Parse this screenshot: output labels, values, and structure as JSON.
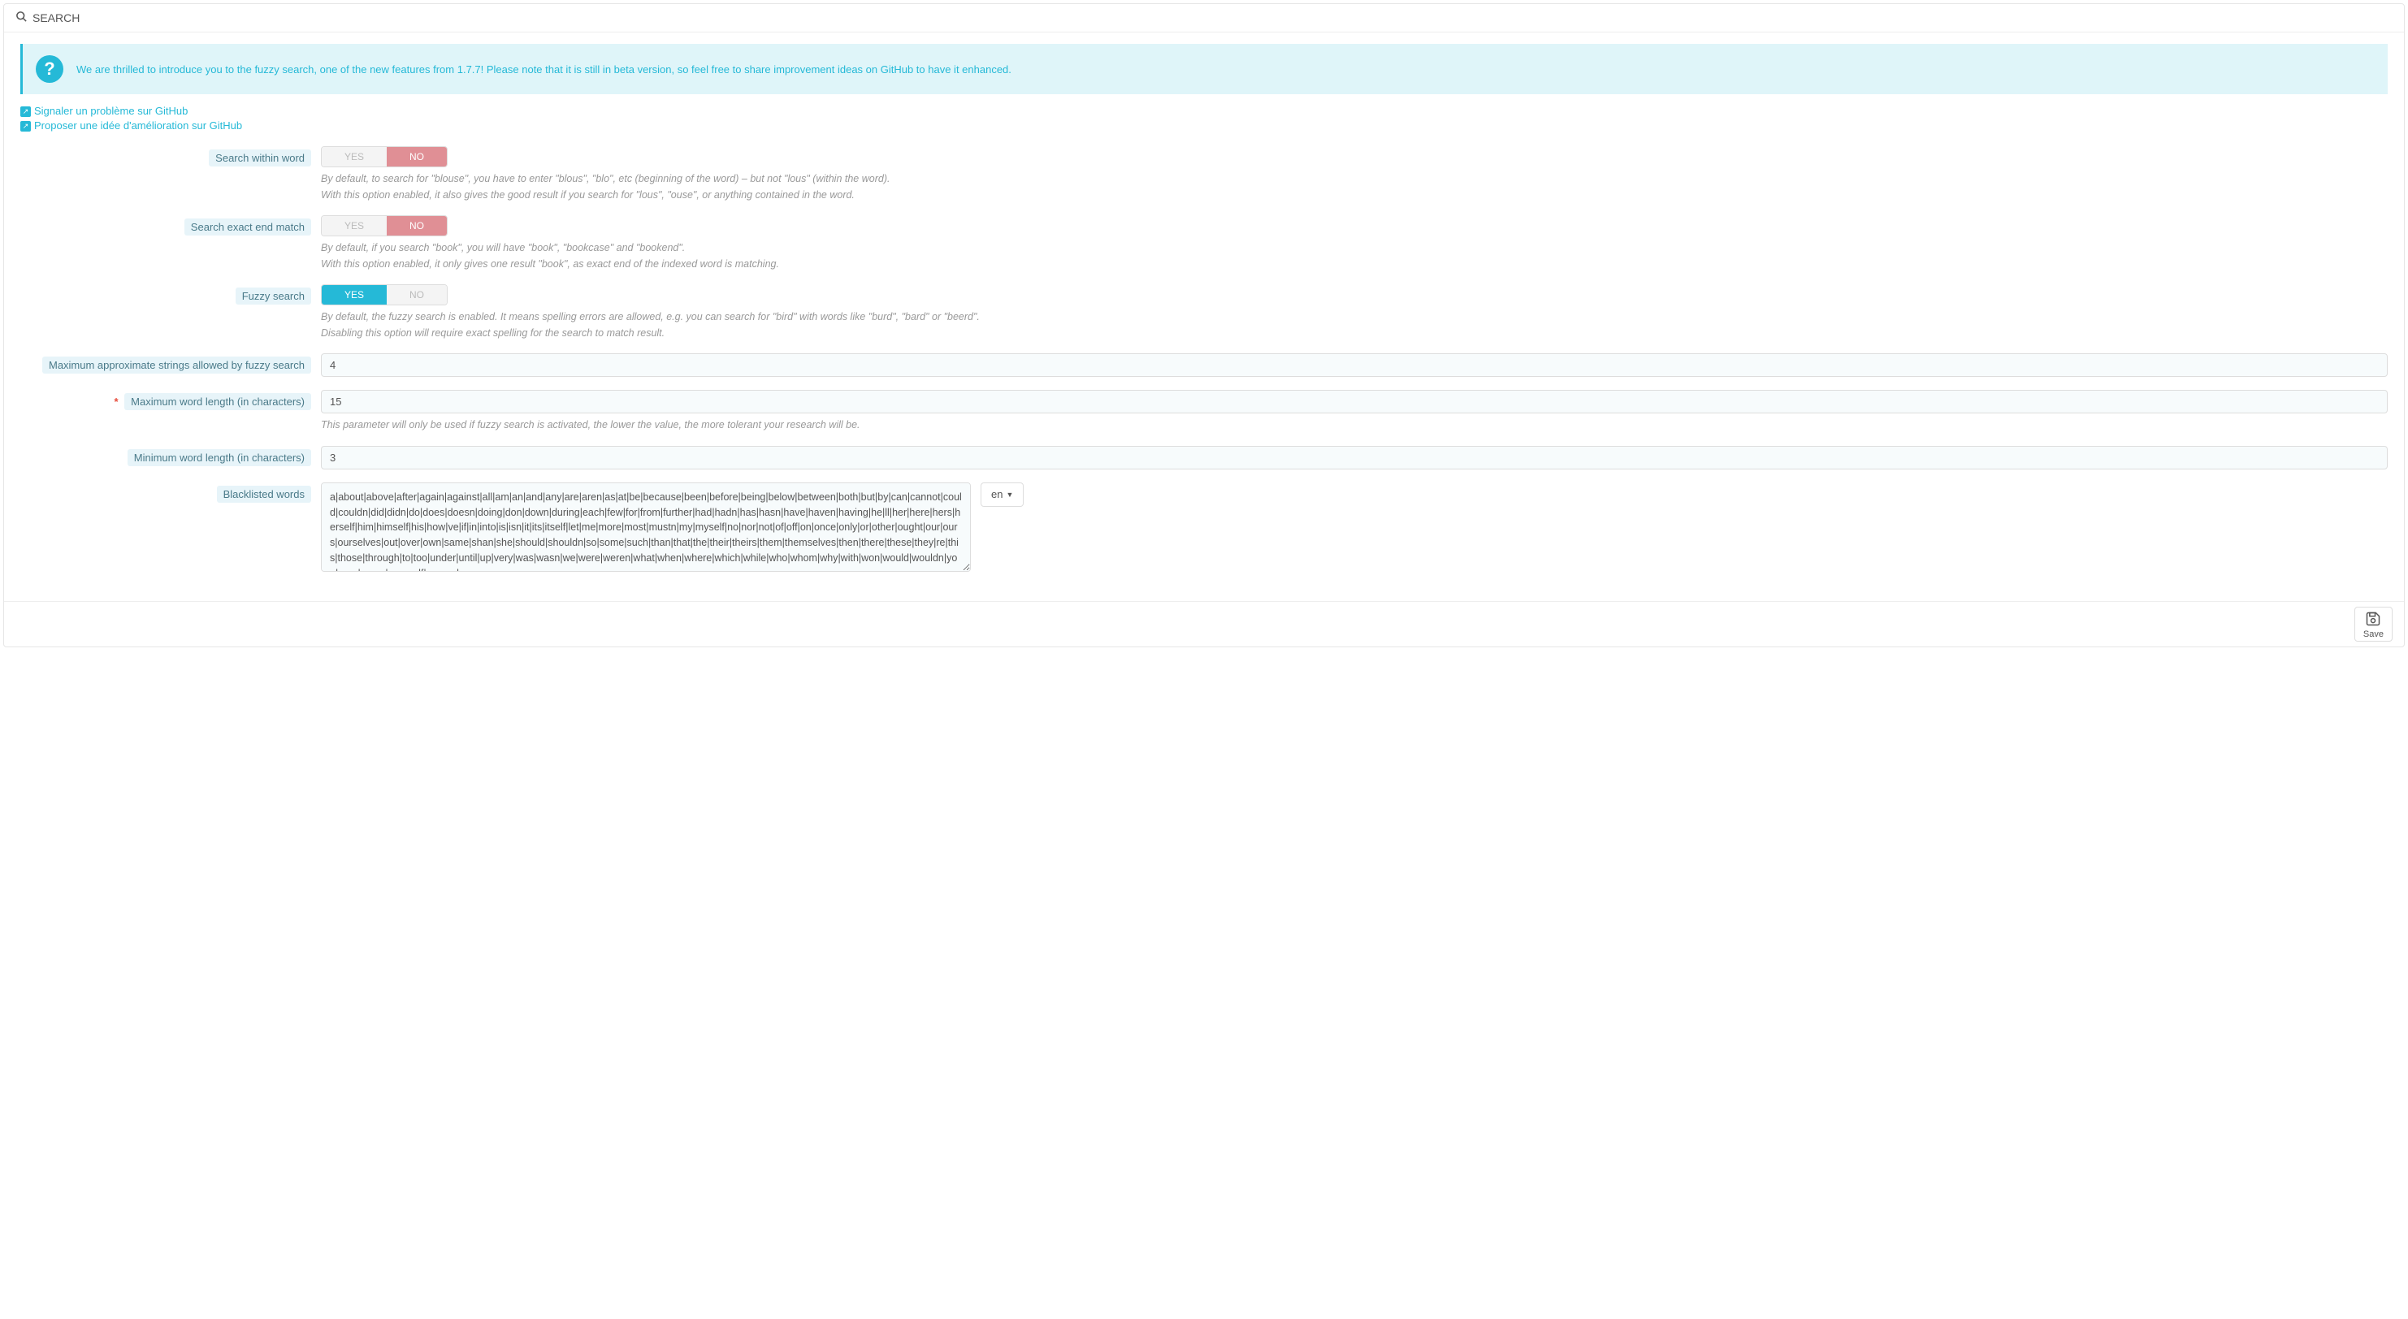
{
  "panel": {
    "title": "SEARCH"
  },
  "alert": {
    "text": "We are thrilled to introduce you to the fuzzy search, one of the new features from 1.7.7! Please note that it is still in beta version, so feel free to share improvement ideas on GitHub to have it enhanced."
  },
  "links": {
    "report": "Signaler un problème sur GitHub",
    "suggest": "Proposer une idée d'amélioration sur GitHub"
  },
  "toggle_labels": {
    "yes": "YES",
    "no": "NO"
  },
  "fields": {
    "search_within_word": {
      "label": "Search within word",
      "value": "no",
      "help1": "By default, to search for \"blouse\", you have to enter \"blous\", \"blo\", etc (beginning of the word) – but not \"lous\" (within the word).",
      "help2": "With this option enabled, it also gives the good result if you search for \"lous\", \"ouse\", or anything contained in the word."
    },
    "search_exact_end": {
      "label": "Search exact end match",
      "value": "no",
      "help1": "By default, if you search \"book\", you will have \"book\", \"bookcase\" and \"bookend\".",
      "help2": "With this option enabled, it only gives one result \"book\", as exact end of the indexed word is matching."
    },
    "fuzzy_search": {
      "label": "Fuzzy search",
      "value": "yes",
      "help1": "By default, the fuzzy search is enabled. It means spelling errors are allowed, e.g. you can search for \"bird\" with words like \"burd\", \"bard\" or \"beerd\".",
      "help2": "Disabling this option will require exact spelling for the search to match result."
    },
    "max_approx": {
      "label": "Maximum approximate strings allowed by fuzzy search",
      "value": "4"
    },
    "max_word_len": {
      "label": "Maximum word length (in characters)",
      "value": "15",
      "required": true,
      "help": "This parameter will only be used if fuzzy search is activated, the lower the value, the more tolerant your research will be."
    },
    "min_word_len": {
      "label": "Minimum word length (in characters)",
      "value": "3"
    },
    "blacklisted": {
      "label": "Blacklisted words",
      "value": "a|about|above|after|again|against|all|am|an|and|any|are|aren|as|at|be|because|been|before|being|below|between|both|but|by|can|cannot|could|couldn|did|didn|do|does|doesn|doing|don|down|during|each|few|for|from|further|had|hadn|has|hasn|have|haven|having|he|ll|her|here|hers|herself|him|himself|his|how|ve|if|in|into|is|isn|it|its|itself|let|me|more|most|mustn|my|myself|no|nor|not|of|off|on|once|only|or|other|ought|our|ours|ourselves|out|over|own|same|shan|she|should|shouldn|so|some|such|than|that|the|their|theirs|them|themselves|then|there|these|they|re|this|those|through|to|too|under|until|up|very|was|wasn|we|were|weren|what|when|where|which|while|who|whom|why|with|won|would|wouldn|you|your|yours|yourself|yourselves",
      "lang": "en"
    }
  },
  "footer": {
    "save": "Save"
  }
}
